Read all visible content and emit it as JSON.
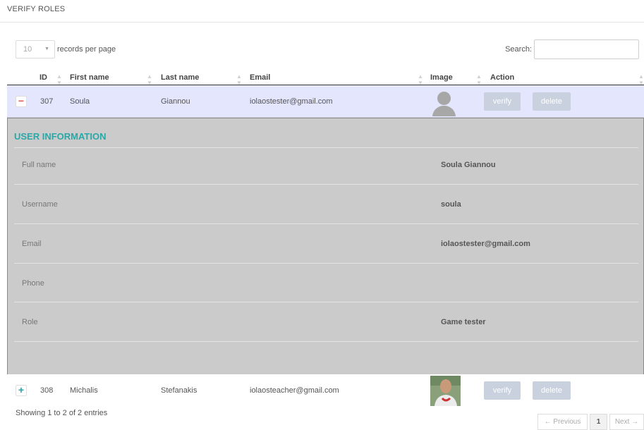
{
  "page": {
    "title": "VERIFY ROLES"
  },
  "controls": {
    "page_length": "10",
    "page_length_label": "records per page",
    "search_label": "Search:",
    "search_value": ""
  },
  "table": {
    "columns": [
      "ID",
      "First name",
      "Last name",
      "Email",
      "Image",
      "Action"
    ],
    "rows": [
      {
        "toggle": "−",
        "id": "307",
        "first_name": "Soula",
        "last_name": "Giannou",
        "email": "iolaostester@gmail.com",
        "image": "default-avatar",
        "verify": "verify",
        "delete": "delete",
        "expanded": true
      },
      {
        "toggle": "+",
        "id": "308",
        "first_name": "Michalis",
        "last_name": "Stefanakis",
        "email": "iolaosteacher@gmail.com",
        "image": "user-photo",
        "verify": "verify",
        "delete": "delete",
        "expanded": false
      }
    ]
  },
  "user_info": {
    "heading": "USER INFORMATION",
    "fields": [
      {
        "label": "Full name",
        "value": "Soula Giannou"
      },
      {
        "label": "Username",
        "value": "soula"
      },
      {
        "label": "Email",
        "value": "iolaostester@gmail.com"
      },
      {
        "label": "Phone",
        "value": ""
      },
      {
        "label": "Role",
        "value": "Game tester"
      }
    ]
  },
  "footer": {
    "info": "Showing 1 to 2 of 2 entries",
    "prev": "← Previous",
    "page": "1",
    "next": "Next →"
  },
  "colors": {
    "accent": "#2aa8a8",
    "selected_row": "#e3e6fd",
    "detail_bg": "#cbcbcb",
    "button": "#c9d1df"
  }
}
